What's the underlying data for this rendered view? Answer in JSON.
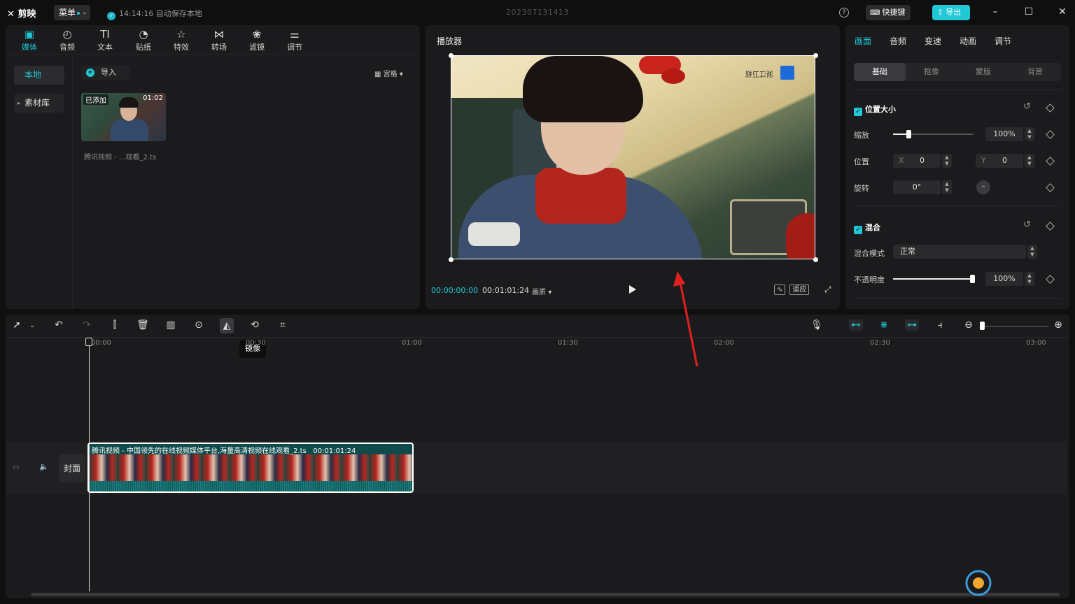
{
  "titlebar": {
    "app_name": "剪映",
    "menu_label": "菜单",
    "autosave_text": "14:14:16 自动保存本地",
    "project_name": "202307131413",
    "shortcut_label": "快捷键",
    "export_label": "导出"
  },
  "media_panel": {
    "tabs": [
      {
        "label": "媒体",
        "icon": "media-icon",
        "active": true
      },
      {
        "label": "音频",
        "icon": "audio-icon"
      },
      {
        "label": "文本",
        "icon": "text-icon"
      },
      {
        "label": "贴纸",
        "icon": "sticker-icon"
      },
      {
        "label": "特效",
        "icon": "effects-icon"
      },
      {
        "label": "转场",
        "icon": "transition-icon"
      },
      {
        "label": "滤镜",
        "icon": "filter-icon"
      },
      {
        "label": "调节",
        "icon": "adjust-icon"
      }
    ],
    "side_items": [
      {
        "label": "本地",
        "active": true
      },
      {
        "label": "素材库"
      }
    ],
    "import_label": "导入",
    "view_label": "宫格",
    "thumbnail": {
      "added_badge": "已添加",
      "duration": "01:02",
      "filename": "腾讯视频 - ...观看_2.ts"
    }
  },
  "player": {
    "title": "播放器",
    "current_time": "00:00:00:00",
    "total_time": "00:01:01:24",
    "quality_label": "画质",
    "ratio_label": "适应",
    "video_watermark": "浙江卫视"
  },
  "properties": {
    "tabs": [
      "画面",
      "音频",
      "变速",
      "动画",
      "调节"
    ],
    "active_tab": "画面",
    "sub_tabs": [
      "基础",
      "抠像",
      "蒙版",
      "背景"
    ],
    "active_sub_tab": "基础",
    "position_size": {
      "title": "位置大小",
      "scale_label": "缩放",
      "scale_value": "100%",
      "scale_fraction": 0.2,
      "position_label": "位置",
      "x_label": "X",
      "x_value": "0",
      "y_label": "Y",
      "y_value": "0",
      "rotate_label": "旋转",
      "rotate_value": "0°"
    },
    "blend": {
      "title": "混合",
      "mode_label": "混合模式",
      "mode_value": "正常",
      "opacity_label": "不透明度",
      "opacity_value": "100%",
      "opacity_fraction": 1.0
    }
  },
  "timeline": {
    "tooltip": "镜像",
    "ruler_labels": [
      "00:00",
      "00:30",
      "01:00",
      "01:30",
      "02:00",
      "02:30",
      "03:00"
    ],
    "cover_label": "封面",
    "clip_label": "腾讯视频 - 中国领先的在线视频媒体平台,海量高清视频在线观看_2.ts",
    "clip_duration": "00:01:01:24"
  },
  "colors": {
    "accent": "#1fc8d4",
    "annotation_arrow": "#e02020"
  }
}
